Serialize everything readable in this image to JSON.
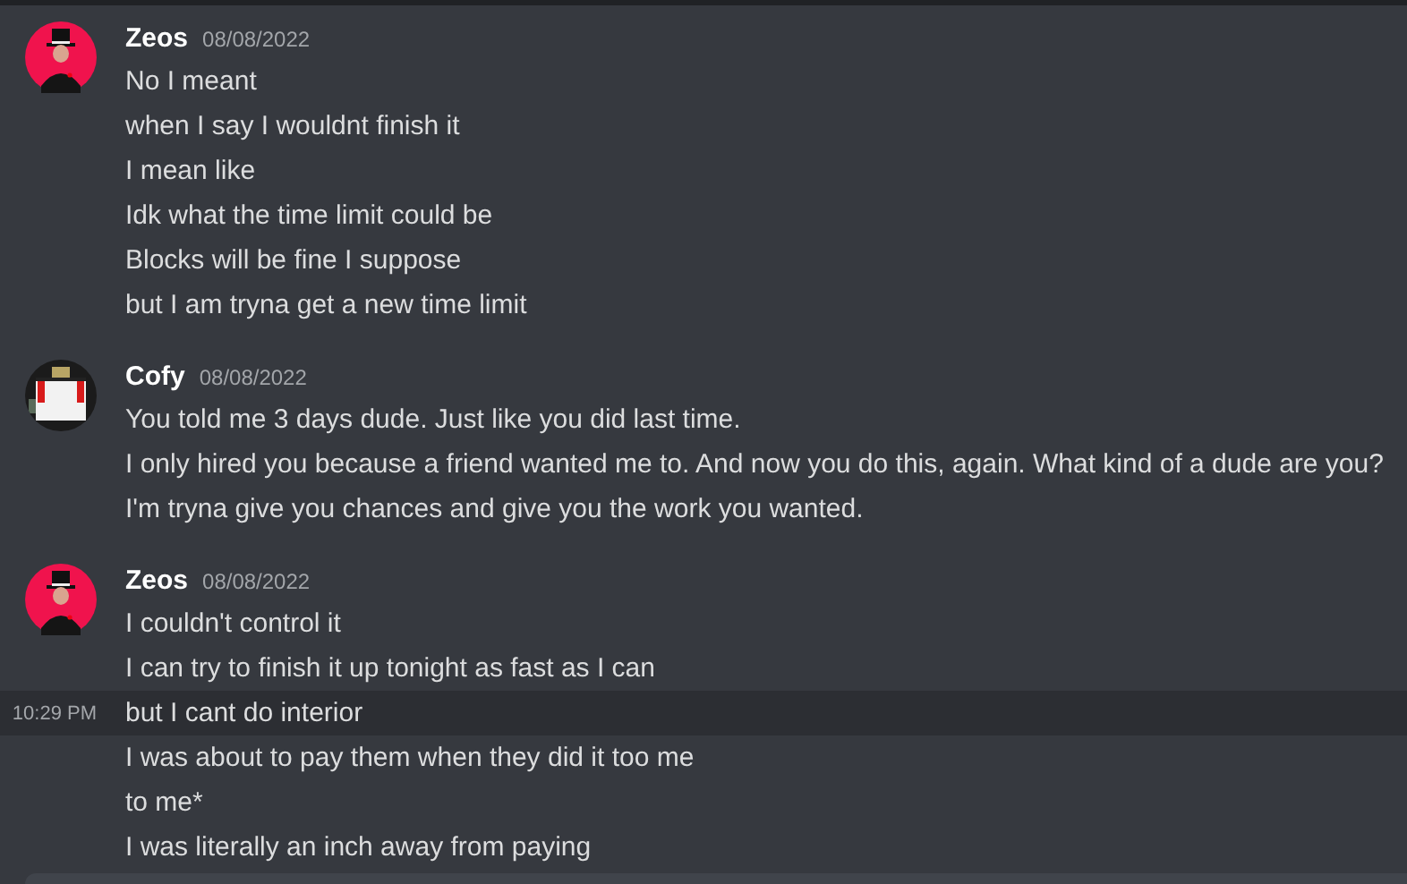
{
  "groups": [
    {
      "author": "Zeos",
      "timestamp": "08/08/2022",
      "kind": "hat",
      "messages": [
        {
          "text": "No I meant",
          "hovered": false
        },
        {
          "text": "when I say I wouldnt finish it",
          "hovered": false
        },
        {
          "text": "I mean like",
          "hovered": false
        },
        {
          "text": "Idk what the time limit could be",
          "hovered": false
        },
        {
          "text": "Blocks will be fine I suppose",
          "hovered": false
        },
        {
          "text": "but I am tryna get a new time limit",
          "hovered": false
        }
      ]
    },
    {
      "author": "Cofy",
      "timestamp": "08/08/2022",
      "kind": "pixel",
      "messages": [
        {
          "text": "You told me 3 days dude. Just like you did last time.",
          "hovered": false
        },
        {
          "text": "I only hired you because a friend wanted me to. And now you do this, again. What kind of a dude are you?",
          "hovered": false
        },
        {
          "text": "I'm tryna give you chances and give you the work you wanted.",
          "hovered": false
        }
      ]
    },
    {
      "author": "Zeos",
      "timestamp": "08/08/2022",
      "kind": "hat",
      "messages": [
        {
          "text": "I couldn't control it",
          "hovered": false
        },
        {
          "text": "I can try to finish it up tonight as fast as I can",
          "hovered": false
        },
        {
          "text": "but I cant do interior",
          "hovered": true,
          "time": "10:29 PM"
        },
        {
          "text": "I was about to pay them when they did it too me",
          "hovered": false
        },
        {
          "text": "to me*",
          "hovered": false
        },
        {
          "text": "I was literally an inch away from paying",
          "hovered": false
        }
      ]
    }
  ]
}
